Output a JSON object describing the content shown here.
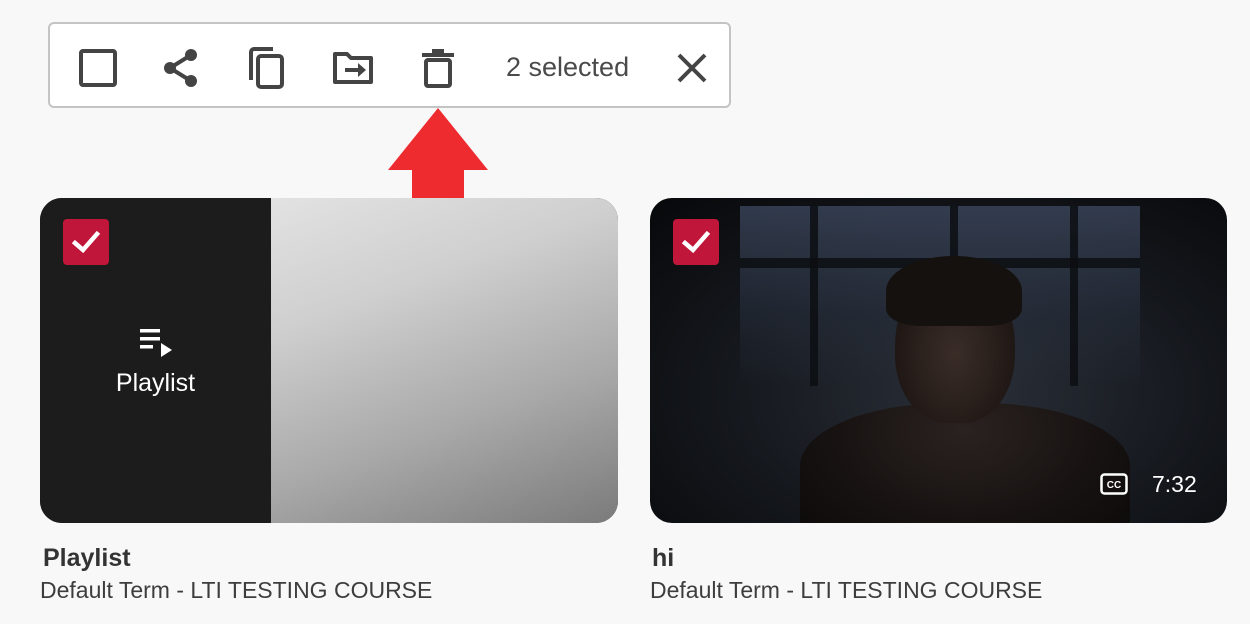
{
  "toolbar": {
    "buttons": [
      {
        "name": "select-all",
        "icon": "checkbox-outline-icon"
      },
      {
        "name": "share",
        "icon": "share-icon"
      },
      {
        "name": "copy",
        "icon": "copy-icon"
      },
      {
        "name": "move",
        "icon": "move-to-folder-icon"
      },
      {
        "name": "delete",
        "icon": "trash-icon"
      }
    ],
    "selected_text": "2 selected",
    "close_icon": "close-icon"
  },
  "annotation": {
    "arrow_color": "#ee2b2f",
    "points_to": "delete"
  },
  "cards": [
    {
      "kind": "playlist",
      "checked": true,
      "badge_icon": "playlist-play-icon",
      "badge_label": "Playlist",
      "title": "Playlist",
      "subtitle": "Default Term - LTI TESTING COURSE"
    },
    {
      "kind": "video",
      "checked": true,
      "captions_icon": "closed-captions-icon",
      "duration": "7:32",
      "title": "hi",
      "subtitle": "Default Term - LTI TESTING COURSE"
    }
  ],
  "colors": {
    "checkbox_checked": "#c0163a",
    "icon": "#444444",
    "arrow": "#ee2b2f"
  }
}
